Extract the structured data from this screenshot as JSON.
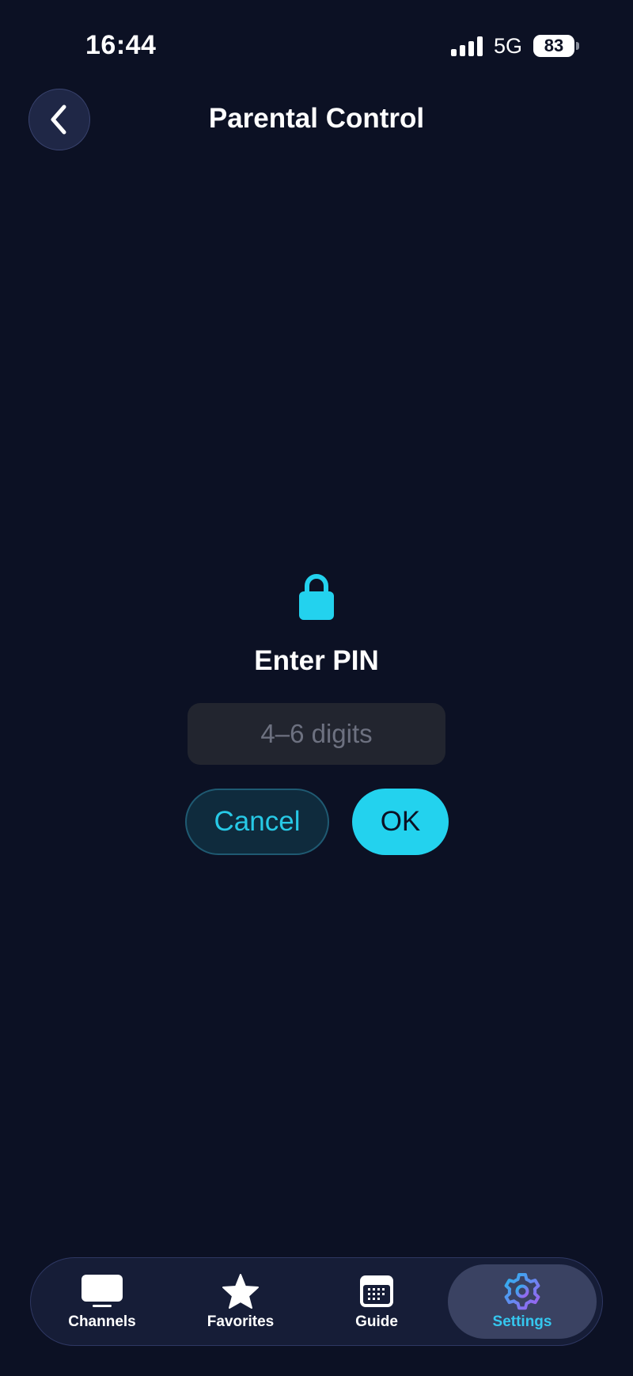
{
  "status_bar": {
    "time": "16:44",
    "network": "5G",
    "battery": "83"
  },
  "header": {
    "title": "Parental Control",
    "back_icon": "chevron-left-icon"
  },
  "pin_dialog": {
    "icon": "lock-icon",
    "heading": "Enter PIN",
    "input_placeholder": "4–6 digits",
    "input_value": "",
    "cancel_label": "Cancel",
    "ok_label": "OK"
  },
  "tab_bar": {
    "tabs": [
      {
        "label": "Channels",
        "icon": "tv-icon",
        "selected": false
      },
      {
        "label": "Favorites",
        "icon": "star-icon",
        "selected": false
      },
      {
        "label": "Guide",
        "icon": "calendar-icon",
        "selected": false
      },
      {
        "label": "Settings",
        "icon": "gear-icon",
        "selected": true
      }
    ]
  },
  "colors": {
    "background": "#0c1124",
    "accent": "#23d2ee",
    "cancel_bg": "#0f2b3d",
    "tab_bar_bg": "#161d37",
    "selected_tab_bg": "#3a4262",
    "input_bg": "#22252f"
  }
}
